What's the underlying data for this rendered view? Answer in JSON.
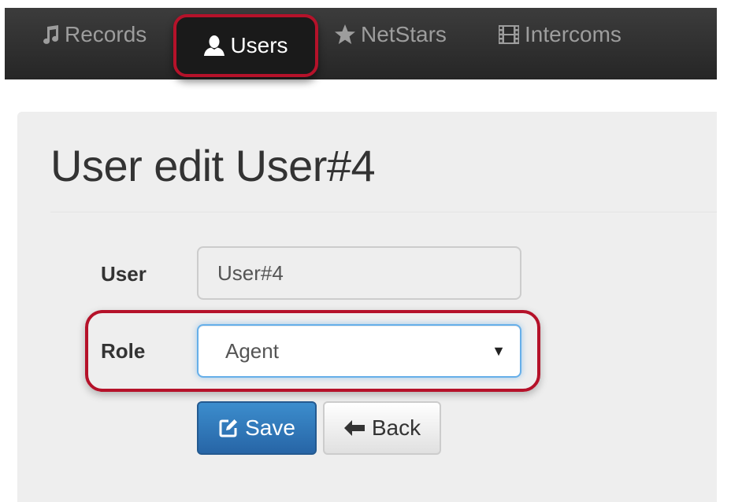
{
  "nav": {
    "items": [
      {
        "label": "Records",
        "icon": "music-icon"
      },
      {
        "label": "Users",
        "icon": "user-icon",
        "active": true
      },
      {
        "label": "NetStars",
        "icon": "star-icon"
      },
      {
        "label": "Intercoms",
        "icon": "film-icon"
      }
    ]
  },
  "page": {
    "title": "User edit User#4"
  },
  "form": {
    "user_label": "User",
    "user_value": "User#4",
    "role_label": "Role",
    "role_value": "Agent",
    "save_label": "Save",
    "back_label": "Back"
  },
  "colors": {
    "navbar_bg": "#2b2b2b",
    "nav_text": "#9d9d9d",
    "nav_active_text": "#ffffff",
    "highlight_border": "#b5122a",
    "panel_bg": "#eeeeee",
    "primary_button": "#337ab7",
    "focus_border": "#66afe9"
  }
}
